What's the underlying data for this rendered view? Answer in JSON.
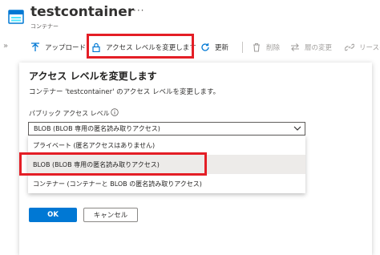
{
  "header": {
    "title": "testcontainer",
    "more": "···",
    "subtitle": "コンテナー"
  },
  "toolbar": {
    "overflow": "»",
    "upload": "アップロード",
    "change_access": "アクセス レベルを変更します",
    "refresh": "更新",
    "delete": "削除",
    "change_tier": "層の変更",
    "lease": "リースの"
  },
  "panel": {
    "title": "アクセス レベルを変更します",
    "description": "コンテナー 'testcontainer' のアクセス レベルを変更します。",
    "field_label": "パブリック アクセス レベル",
    "selected_value": "BLOB (BLOB 専用の匿名読み取りアクセス)",
    "options": [
      "プライベート (匿名アクセスはありません)",
      "BLOB (BLOB 専用の匿名読み取りアクセス)",
      "コンテナー (コンテナーと BLOB の匿名読み取りアクセス)"
    ],
    "ok": "OK",
    "cancel": "キャンセル"
  },
  "colors": {
    "accent": "#0078d4",
    "highlight": "#e41e26"
  }
}
